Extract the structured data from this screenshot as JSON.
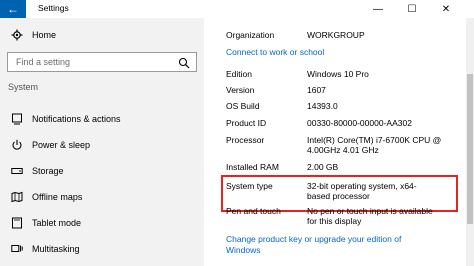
{
  "window": {
    "title": "Settings",
    "back_glyph": "←",
    "minimize_glyph": "—",
    "maximize_glyph": "☐",
    "close_glyph": "✕"
  },
  "sidebar": {
    "home_label": "Home",
    "search_placeholder": "Find a setting",
    "section_label": "System",
    "items": [
      {
        "label": "Notifications & actions",
        "icon": "notifications-icon"
      },
      {
        "label": "Power & sleep",
        "icon": "power-icon"
      },
      {
        "label": "Storage",
        "icon": "storage-icon"
      },
      {
        "label": "Offline maps",
        "icon": "map-icon"
      },
      {
        "label": "Tablet mode",
        "icon": "tablet-icon"
      },
      {
        "label": "Multitasking",
        "icon": "multitasking-icon"
      }
    ]
  },
  "about": {
    "organization_label": "Organization",
    "organization_value": "WORKGROUP",
    "connect_link": "Connect to work or school",
    "edition_label": "Edition",
    "edition_value": "Windows 10 Pro",
    "version_label": "Version",
    "version_value": "1607",
    "build_label": "OS Build",
    "build_value": "14393.0",
    "product_id_label": "Product ID",
    "product_id_value": "00330-80000-00000-AA302",
    "processor_label": "Processor",
    "processor_value_line1": "Intel(R) Core(TM) i7-6700K CPU @",
    "processor_value_line2": "4.00GHz   4.01 GHz",
    "ram_label": "Installed RAM",
    "ram_value": "2.00 GB",
    "system_type_label": "System type",
    "system_type_value_line1": "32-bit operating system, x64-",
    "system_type_value_line2": "based processor",
    "pen_label": "Pen and touch",
    "pen_value_line1": "No pen or touch input is available",
    "pen_value_line2": "for this display",
    "change_key_link_line1": "Change product key or upgrade your edition of",
    "change_key_link_line2": "Windows"
  },
  "colors": {
    "accent": "#0063b1",
    "link": "#0066cc",
    "highlight_border": "#e0261e",
    "sidebar_bg": "#f2f2f2"
  }
}
